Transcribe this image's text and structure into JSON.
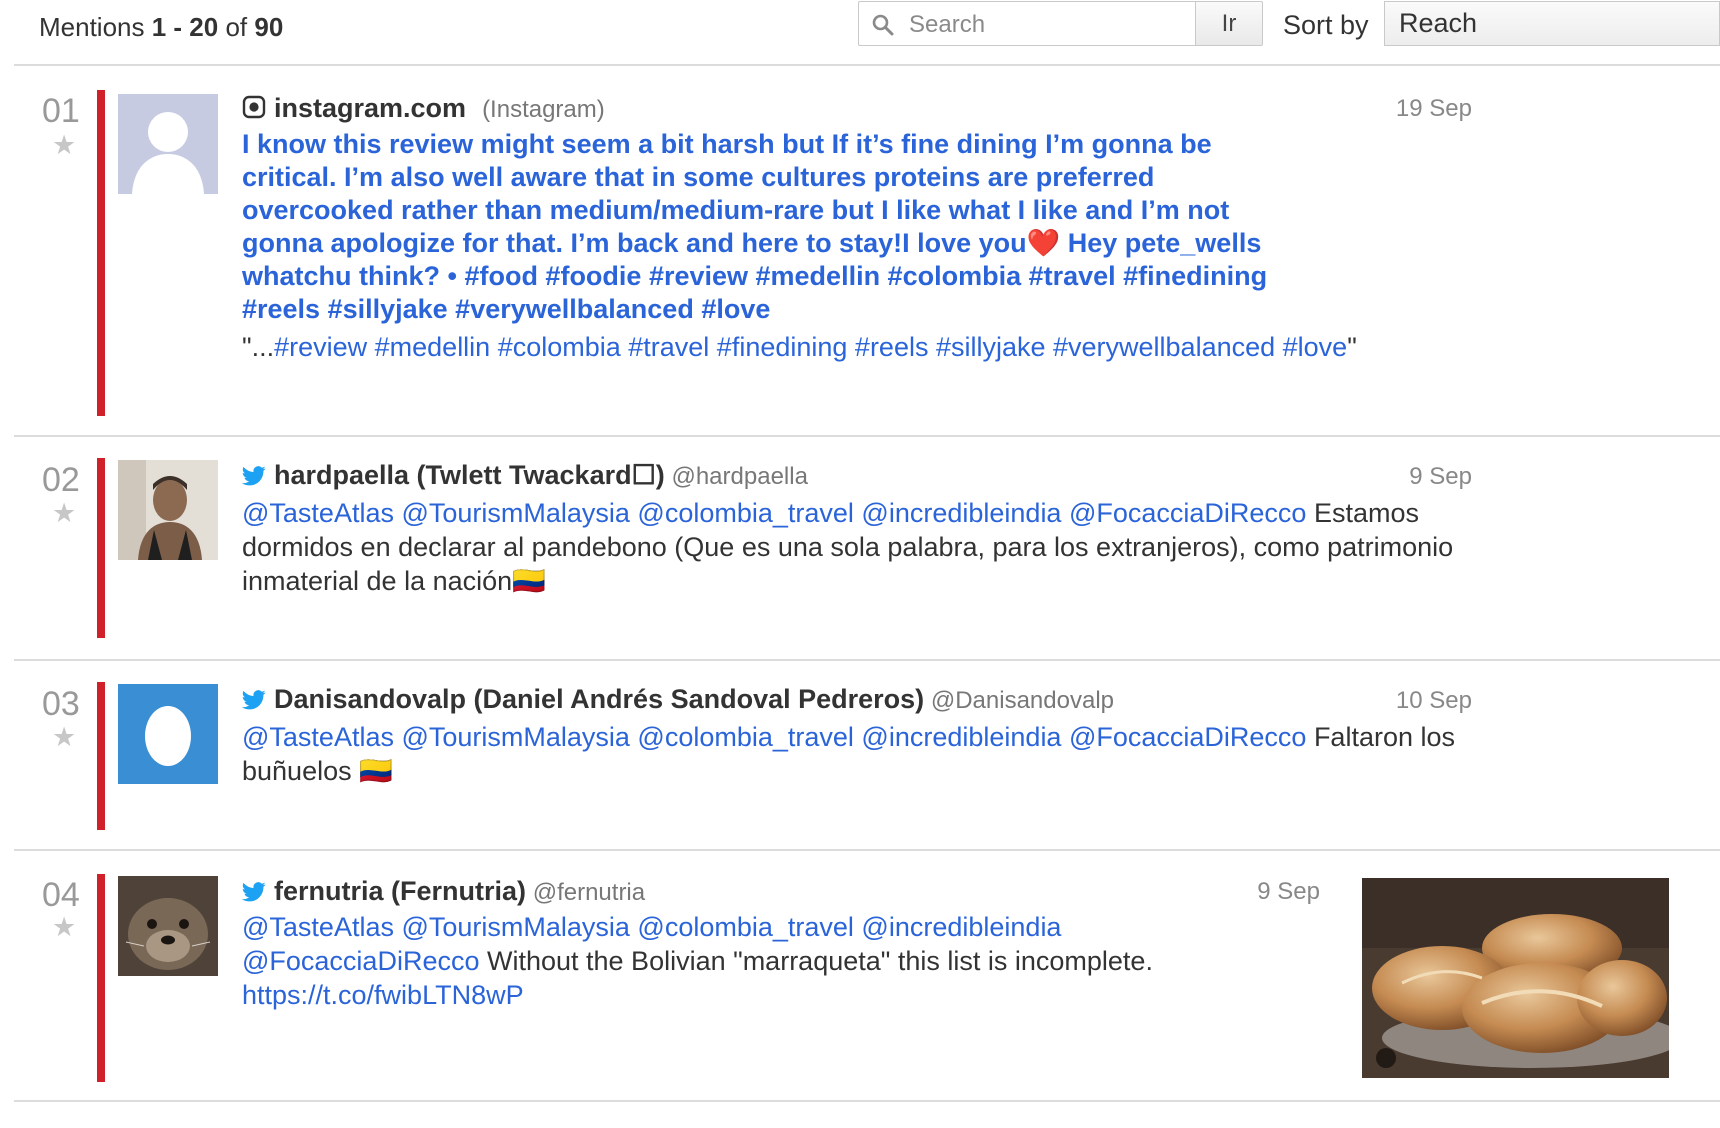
{
  "header": {
    "mentions_prefix": "Mentions ",
    "range": "1 - 20",
    "of_text": " of ",
    "total": "90",
    "search_placeholder": "Search",
    "go_label": "Ir",
    "sort_label": "Sort by",
    "sort_value": "Reach"
  },
  "mentions": [
    {
      "rank": "01",
      "icon": "instagram-icon",
      "domain": "instagram.com",
      "source": "(Instagram)",
      "date": "19 Sep",
      "lead_text": "I know this review might seem a bit harsh but If it’s fine dining I’m gonna be critical. I’m also well aware that in some cultures proteins are preferred overcooked rather than medium/medium-rare but I like what I like and I’m not gonna apologize for that. I’m back and here to stay!I love you❤️ Hey pete_wells whatchu think? • #food #foodie #review #medellin #colombia #travel #finedining #reels #sillyjake #verywellbalanced #love",
      "quote_open": "\"...",
      "quote_text": "#review #medellin #colombia #travel #finedining #reels #sillyjake #verywellbalanced #love",
      "quote_close": "\""
    },
    {
      "rank": "02",
      "icon": "twitter-icon",
      "author": "hardpaella (Twlett Twackard☐)",
      "handle": "@hardpaella",
      "date": "9 Sep",
      "mentions_text": "@TasteAtlas @TourismMalaysia @colombia_travel @incredibleindia @FocacciaDiRecco",
      "text": " Estamos dormidos en declarar al pandebono (Que es una sola palabra, para los extranjeros), como patrimonio inmaterial de la nación🇨🇴"
    },
    {
      "rank": "03",
      "icon": "twitter-icon",
      "author": "Danisandovalp (Daniel Andrés Sandoval Pedreros)",
      "handle": "@Danisandovalp",
      "date": "10 Sep",
      "mentions_text": "@TasteAtlas @TourismMalaysia @colombia_travel @incredibleindia @FocacciaDiRecco",
      "text": " Faltaron los buñuelos 🇨🇴"
    },
    {
      "rank": "04",
      "icon": "twitter-icon",
      "author": "fernutria (Fernutria)",
      "handle": "@fernutria",
      "date": "9 Sep",
      "mentions_text": "@TasteAtlas @TourismMalaysia @colombia_travel @incredibleindia @FocacciaDiRecco",
      "text": " Without the Bolivian \"marraqueta\" this list is incomplete. ",
      "link": "https://t.co/fwibLTN8wP"
    }
  ],
  "colors": {
    "accent_bar": "#d0212b",
    "link": "#2a64d8",
    "twitter": "#1da1f2"
  }
}
